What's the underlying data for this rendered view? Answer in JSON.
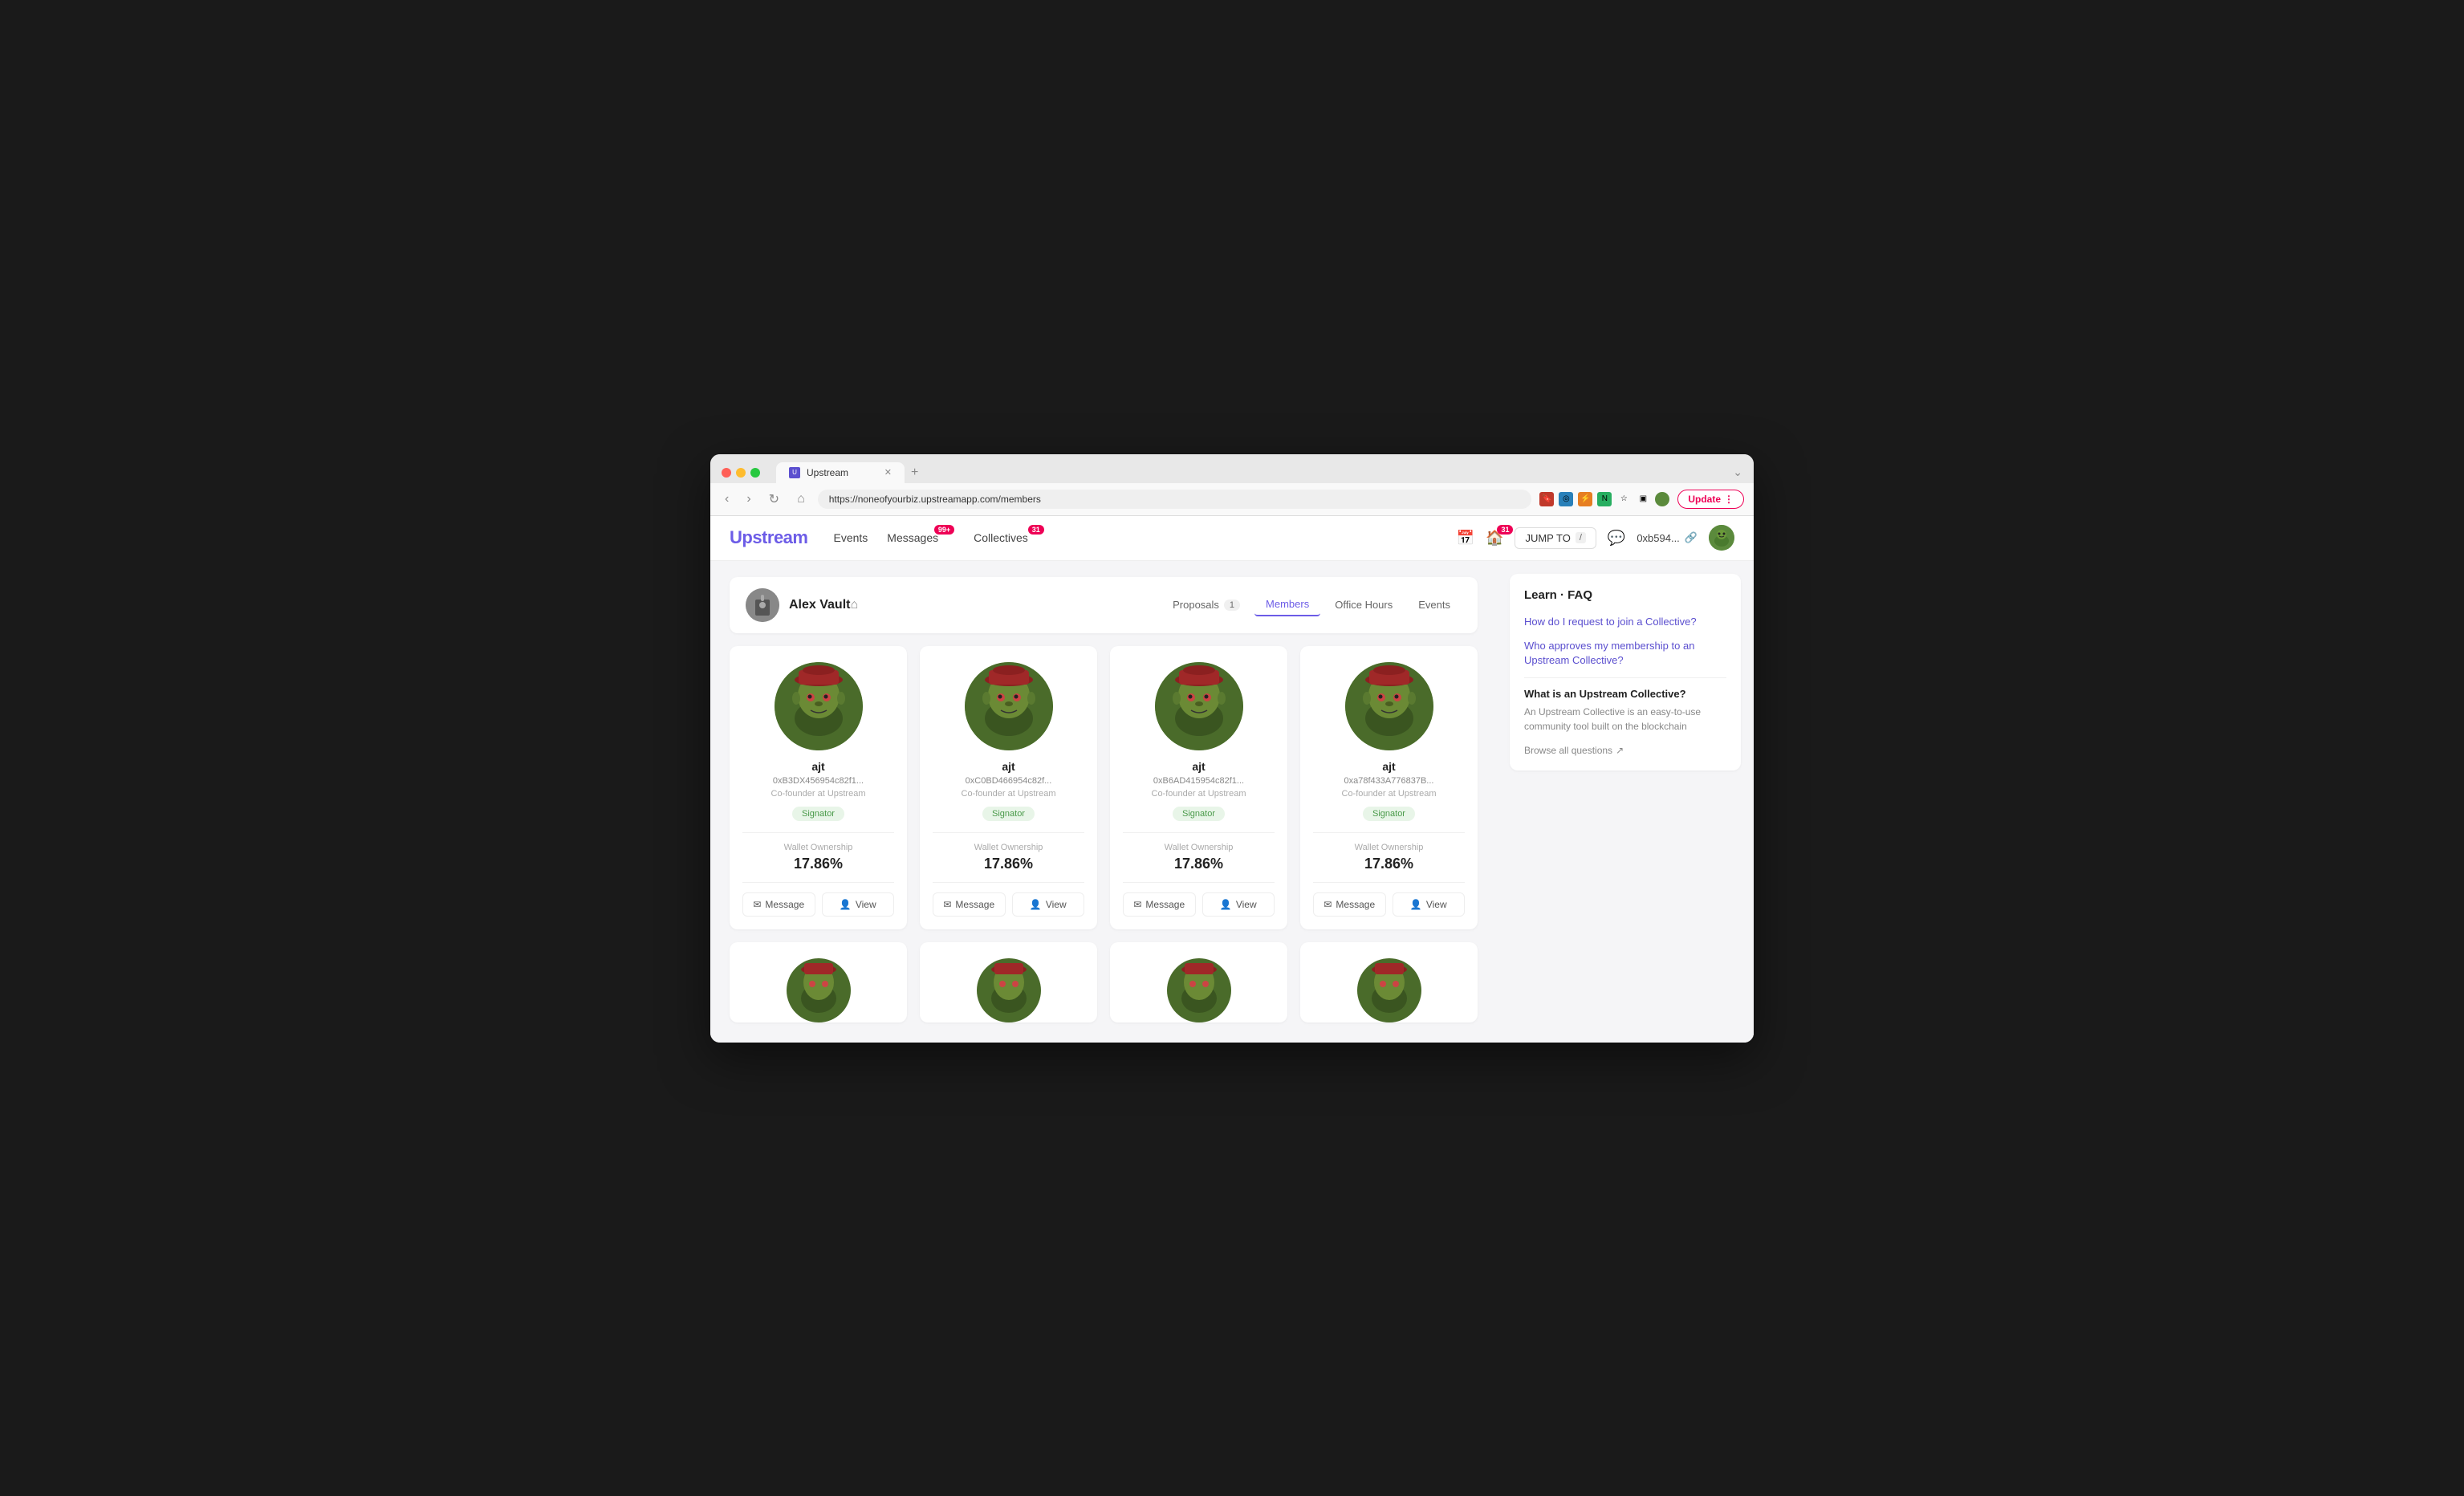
{
  "browser": {
    "tab_title": "Upstream",
    "url": "https://noneofyourbiz.upstreamapp.com/members",
    "update_label": "Update"
  },
  "app": {
    "logo": "Upstream",
    "nav": [
      {
        "label": "Events",
        "badge": null
      },
      {
        "label": "Messages",
        "badge": "99+"
      },
      {
        "label": "Collectives",
        "badge": "31"
      }
    ],
    "jump_to_label": "JUMP TO",
    "jump_shortcut": "/",
    "wallet_address": "0xb594...",
    "home_badge": "31"
  },
  "vault": {
    "name": "Alex Vault",
    "tabs": [
      {
        "label": "Proposals",
        "count": "1",
        "active": false
      },
      {
        "label": "Members",
        "count": null,
        "active": true
      },
      {
        "label": "Office Hours",
        "count": null,
        "active": false
      },
      {
        "label": "Events",
        "count": null,
        "active": false
      }
    ]
  },
  "members": [
    {
      "username": "ajt",
      "address": "0xB3DX456954c82f1...",
      "title": "Co-founder at Upstream",
      "badge": "Signator",
      "wallet_ownership_label": "Wallet Ownership",
      "wallet_ownership_pct": "17.86%",
      "message_label": "Message",
      "view_label": "View"
    },
    {
      "username": "ajt",
      "address": "0xC0BD466954c82f...",
      "title": "Co-founder at Upstream",
      "badge": "Signator",
      "wallet_ownership_label": "Wallet Ownership",
      "wallet_ownership_pct": "17.86%",
      "message_label": "Message",
      "view_label": "View"
    },
    {
      "username": "ajt",
      "address": "0xB6AD415954c82f1...",
      "title": "Co-founder at Upstream",
      "badge": "Signator",
      "wallet_ownership_label": "Wallet Ownership",
      "wallet_ownership_pct": "17.86%",
      "message_label": "Message",
      "view_label": "View"
    },
    {
      "username": "ajt",
      "address": "0xa78f433A776837B...",
      "title": "Co-founder at Upstream",
      "badge": "Signator",
      "wallet_ownership_label": "Wallet Ownership",
      "wallet_ownership_pct": "17.86%",
      "message_label": "Message",
      "view_label": "View"
    }
  ],
  "faq": {
    "title": "Learn · FAQ",
    "questions": [
      "How do I request to join a Collective?",
      "Who approves my membership to an Upstream Collective?"
    ],
    "featured_question": "What is an Upstream Collective?",
    "featured_answer": "An Upstream Collective is an easy-to-use community tool built on the blockchain",
    "browse_label": "Browse all questions"
  }
}
